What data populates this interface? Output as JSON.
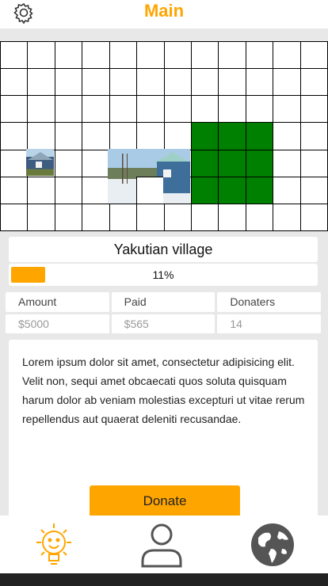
{
  "header": {
    "title": "Main"
  },
  "icons": {
    "settings": "gear-icon",
    "nav_home": "lightbulb-sun-icon",
    "nav_profile": "user-icon",
    "nav_world": "globe-icon"
  },
  "map": {
    "images": [
      "house-photo-small",
      "village-photo-large"
    ]
  },
  "project": {
    "name": "Yakutian village",
    "progress": 0.11,
    "progress_label": "11%",
    "stats": {
      "amount_label": "Amount",
      "paid_label": "Paid",
      "donaters_label": "Donaters",
      "amount_value": "$5000",
      "paid_value": "$565",
      "donaters_value": "14"
    },
    "description": "Lorem ipsum dolor sit amet, consectetur adipisicing elit. Velit non, sequi amet obcaecati quos soluta quisquam harum dolor ab veniam molestias excepturi ut vitae rerum repellendus aut quaerat deleniti recusandae.",
    "donate_label": "Donate"
  },
  "colors": {
    "accent": "#ffa500",
    "funded_cell": "#008000",
    "text": "#111111",
    "muted_text": "#9a9a9a"
  }
}
